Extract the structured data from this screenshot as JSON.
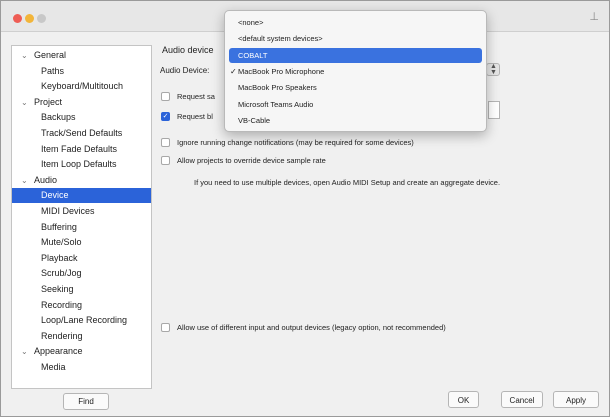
{
  "sidebar": {
    "items": [
      {
        "label": "General",
        "level": 0,
        "expanded": true,
        "selected": false
      },
      {
        "label": "Paths",
        "level": 1,
        "selected": false
      },
      {
        "label": "Keyboard/Multitouch",
        "level": 1,
        "selected": false
      },
      {
        "label": "Project",
        "level": 0,
        "expanded": true,
        "selected": false
      },
      {
        "label": "Backups",
        "level": 1,
        "selected": false
      },
      {
        "label": "Track/Send Defaults",
        "level": 1,
        "selected": false
      },
      {
        "label": "Item Fade Defaults",
        "level": 1,
        "selected": false
      },
      {
        "label": "Item Loop Defaults",
        "level": 1,
        "selected": false
      },
      {
        "label": "Audio",
        "level": 0,
        "expanded": true,
        "selected": false
      },
      {
        "label": "Device",
        "level": 1,
        "selected": true
      },
      {
        "label": "MIDI Devices",
        "level": 1,
        "selected": false
      },
      {
        "label": "Buffering",
        "level": 1,
        "selected": false
      },
      {
        "label": "Mute/Solo",
        "level": 1,
        "selected": false
      },
      {
        "label": "Playback",
        "level": 1,
        "selected": false
      },
      {
        "label": "Scrub/Jog",
        "level": 1,
        "selected": false
      },
      {
        "label": "Seeking",
        "level": 1,
        "selected": false
      },
      {
        "label": "Recording",
        "level": 1,
        "selected": false
      },
      {
        "label": "Loop/Lane Recording",
        "level": 1,
        "selected": false
      },
      {
        "label": "Rendering",
        "level": 1,
        "selected": false
      },
      {
        "label": "Appearance",
        "level": 0,
        "expanded": true,
        "selected": false
      },
      {
        "label": "Media",
        "level": 1,
        "selected": false
      }
    ]
  },
  "find_label": "Find",
  "content": {
    "section_title": "Audio device",
    "audio_device_label": "Audio Device:",
    "checkboxes": [
      {
        "label": "Request sa",
        "checked": false
      },
      {
        "label": "Request bl",
        "checked": true
      },
      {
        "label": "Ignore running change notifications (may be required for some devices)",
        "checked": false
      },
      {
        "label": "Allow projects to override device sample rate",
        "checked": false
      }
    ],
    "info": "If you need to use multiple devices, open Audio MIDI Setup and create an aggregate device.",
    "legacy_checkbox": {
      "label": "Allow use of different input and output devices (legacy option, not recommended)",
      "checked": false
    }
  },
  "dropdown": {
    "items": [
      {
        "label": "<none>",
        "highlighted": false,
        "checked": false
      },
      {
        "label": "<default system devices>",
        "highlighted": false,
        "checked": false
      },
      {
        "label": "COBALT",
        "highlighted": true,
        "checked": false
      },
      {
        "label": "MacBook Pro Microphone",
        "highlighted": false,
        "checked": true
      },
      {
        "label": "MacBook Pro Speakers",
        "highlighted": false,
        "checked": false
      },
      {
        "label": "Microsoft Teams Audio",
        "highlighted": false,
        "checked": false
      },
      {
        "label": "VB-Cable",
        "highlighted": false,
        "checked": false
      }
    ]
  },
  "buttons": {
    "ok": "OK",
    "cancel": "Cancel",
    "apply": "Apply"
  },
  "colors": {
    "selection": "#2b63d9",
    "highlight": "#3a72df"
  }
}
